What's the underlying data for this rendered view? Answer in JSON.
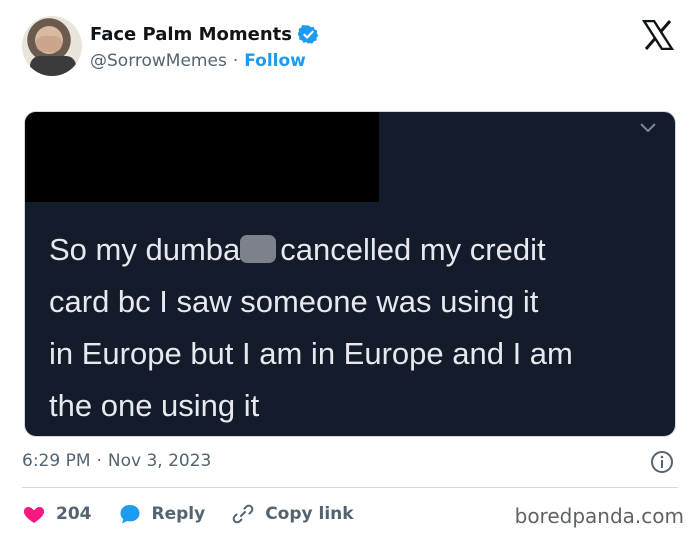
{
  "account": {
    "display_name": "Face Palm Moments",
    "handle": "@SorrowMemes",
    "separator": "·",
    "follow_label": "Follow",
    "verified": true
  },
  "post": {
    "media_text_lines": [
      "So my dumba",
      "cancelled my credit",
      "card bc I saw someone was using it",
      "in Europe but I am in Europe and I am",
      "the one using it"
    ],
    "time": "6:29 PM",
    "date": "Nov 3, 2023",
    "separator": "·"
  },
  "actions": {
    "like_count": "204",
    "reply_label": "Reply",
    "copy_link_label": "Copy link"
  },
  "watermark": "boredpanda.com",
  "colors": {
    "accent": "#1d9bf0",
    "like": "#f91880",
    "media_bg": "#141c2b",
    "text_secondary": "#536471"
  },
  "icons": [
    "verified-badge-icon",
    "x-logo-icon",
    "chevron-down-icon",
    "info-icon",
    "heart-icon",
    "reply-bubble-icon",
    "link-icon"
  ]
}
